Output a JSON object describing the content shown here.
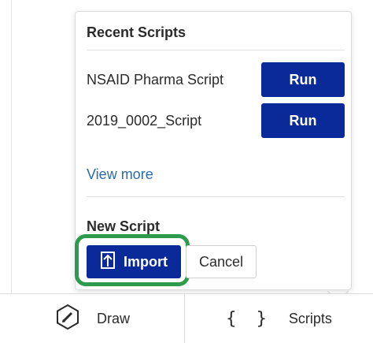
{
  "popover": {
    "recent_title": "Recent Scripts",
    "scripts": [
      {
        "name": "NSAID Pharma Script",
        "action": "Run"
      },
      {
        "name": "2019_0002_Script",
        "action": "Run"
      }
    ],
    "view_more": "View more",
    "new_title": "New Script",
    "import_label": "Import",
    "cancel_label": "Cancel"
  },
  "bottom_bar": {
    "draw_label": "Draw",
    "scripts_label": "Scripts",
    "scripts_icon_glyph": "{ }"
  },
  "colors": {
    "primary": "#0a2a9a",
    "link": "#2c6aa8",
    "highlight": "#2e9a4c"
  },
  "icons": [
    "pencil-icon",
    "upload-icon",
    "braces-icon"
  ]
}
